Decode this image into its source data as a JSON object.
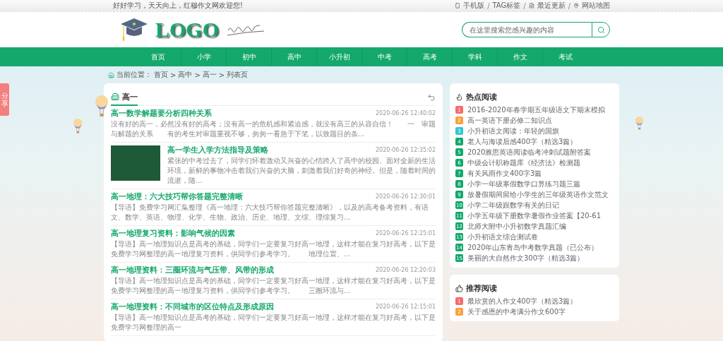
{
  "top_bar": {
    "welcome": "好好学习，天天向上，红穆作文网欢迎您!",
    "separator": "/",
    "links": [
      {
        "label": "手机版",
        "kind": "phone"
      },
      {
        "label": "TAG标签",
        "kind": "none"
      },
      {
        "label": "最近更新",
        "kind": "update"
      },
      {
        "label": "网站地图",
        "kind": "map"
      }
    ]
  },
  "header": {
    "logo": "LOGO",
    "search": {
      "placeholder": "在这里搜索您感兴趣的内容"
    }
  },
  "nav": [
    "首页",
    "小学",
    "初中",
    "高中",
    "小升初",
    "中考",
    "高考",
    "学科",
    "作文",
    "考试"
  ],
  "share": "分享",
  "breadcrumb": {
    "label": "当前位置：",
    "items": [
      "首页",
      "高中",
      "高一",
      "列表页"
    ],
    "separator": ">"
  },
  "list": {
    "title": "高一",
    "articles": [
      {
        "title": "高一数学解题要分析四种关系",
        "date": "2020-06-26 12:40:02",
        "has_image": false,
        "summary": "没有好的高一，必然没有好的高考；没有高一的危机感和紧迫感，就没有高三的从容自信！　　一　审题与解题的关系　　有的考生对审题重视不够，匆匆一看急于下笔，以致题目的条..."
      },
      {
        "title": "高一学生入学方法指导及策略",
        "date": "2020-06-26 12:35:02",
        "has_image": true,
        "summary": "紧张的中考过去了，同学们怀着激动又兴奋的心情跨入了高中的校园。面对全新的生活环境，新鲜的事物冲击着我们兴奋的大脑，刺激着我们好奇的神经。但是，随着时间的流逝，随..."
      },
      {
        "title": "高一地理：六大技巧帮你答题完整清晰",
        "date": "2020-06-26 12:30:01",
        "has_image": false,
        "summary": "【导语】免费学习网汇集整理《高一地理：六大技巧帮你答题完整清晰》，以及的高考备考资料，有语文、数学、英语、物理、化学、生物、政治、历史、地理、文综、理综复习..."
      },
      {
        "title": "高一地理复习资料：影响气候的因素",
        "date": "2020-06-26 12:25:01",
        "has_image": false,
        "summary": "【导语】高一地理知识点是高考的基础，同学们一定要复习好高一地理，这样才能在复习好高考，以下是免费学习网整理的高一地理复习资料，供同学们参考学习。　　地理位置、..."
      },
      {
        "title": "高一地理资料：三圈环流与气压带、风带的形成",
        "date": "2020-06-26 12:20:03",
        "has_image": false,
        "summary": "【导语】高一地理知识点是高考的基础，同学们一定要复习好高一地理，这样才能在复习好高考，以下是免费学习网整理的高一地理复习资料，供同学们参考学习。　　三圈环流与..."
      },
      {
        "title": "高一地理资料：不同城市的区位特点及形成原因",
        "date": "2020-06-26 12:15:01",
        "has_image": false,
        "summary": "【导语】高一地理知识点是高考的基础，同学们一定要复习好高一地理，这样才能在复习好高考，以下是免费学习网整理的高一"
      }
    ]
  },
  "sidebar": [
    {
      "title": "热点阅读",
      "kind": "hot",
      "items": [
        {
          "rank": "1",
          "color": "#f86b6b",
          "text": "2016-2020年春学期五年级语文下期末模拟"
        },
        {
          "rank": "2",
          "color": "#f9a03f",
          "text": "高一英语下册必修二知识点"
        },
        {
          "rank": "3",
          "color": "#35c6d3",
          "text": "小升初语文阅读：年轻的国旗"
        },
        {
          "rank": "4",
          "color": "#14a86c",
          "text": "老人与海读后感400字（精选3篇）"
        },
        {
          "rank": "5",
          "color": "#14a86c",
          "text": "2020雅思英语阅读临考冲刺试题附答案"
        },
        {
          "rank": "6",
          "color": "#14a86c",
          "text": "中级会计职称题库《经济法》检测题"
        },
        {
          "rank": "7",
          "color": "#14a86c",
          "text": "有关风雨作文400字3篇"
        },
        {
          "rank": "8",
          "color": "#14a86c",
          "text": "小学一年级寒假数学口算练习题三篇"
        },
        {
          "rank": "9",
          "color": "#14a86c",
          "text": "放暑假期间留给小学生的三年级英语作文范文"
        },
        {
          "rank": "10",
          "color": "#14a86c",
          "text": "小学二年级跟数学有关的日记"
        },
        {
          "rank": "11",
          "color": "#14a86c",
          "text": "小学五年级下册数学暑假作业答案【20-61"
        },
        {
          "rank": "12",
          "color": "#14a86c",
          "text": "北师大附中小升初数学真题汇编"
        },
        {
          "rank": "13",
          "color": "#14a86c",
          "text": "小升初语文综合测试卷"
        },
        {
          "rank": "14",
          "color": "#14a86c",
          "text": "2020年山东青岛中考数学真题（已公布）"
        },
        {
          "rank": "15",
          "color": "#14a86c",
          "text": "美丽的大自然作文300字（精选3篇）"
        }
      ]
    },
    {
      "title": "推荐阅读",
      "kind": "recommend",
      "items": [
        {
          "rank": "1",
          "color": "#f86b6b",
          "text": "最欣赏的人作文400字（精选3篇）"
        },
        {
          "rank": "2",
          "color": "#f9a03f",
          "text": "关于感恩的中考满分作文600字"
        }
      ]
    }
  ]
}
